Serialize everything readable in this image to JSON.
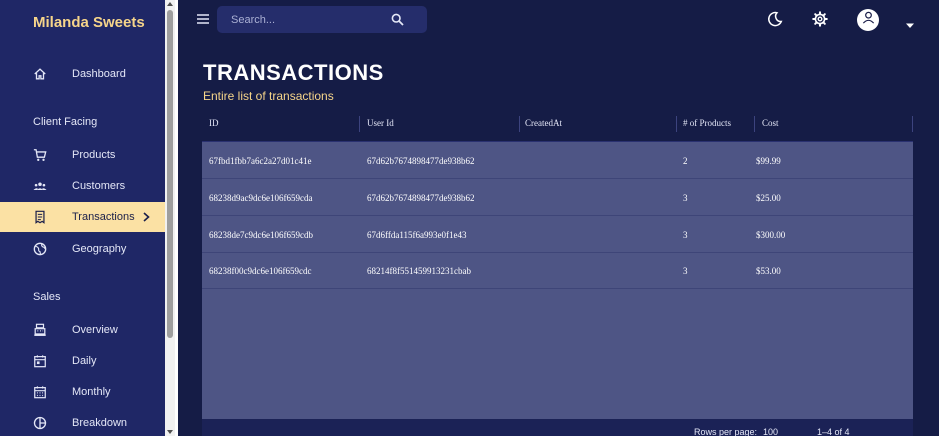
{
  "sidebar": {
    "brand": "Milanda Sweets",
    "items": [
      {
        "label": "Dashboard"
      },
      {
        "label": "Products"
      },
      {
        "label": "Customers"
      },
      {
        "label": "Transactions"
      },
      {
        "label": "Geography"
      },
      {
        "label": "Overview"
      },
      {
        "label": "Daily"
      },
      {
        "label": "Monthly"
      },
      {
        "label": "Breakdown"
      }
    ],
    "sections": [
      "Client Facing",
      "Sales"
    ],
    "active_item": "Transactions"
  },
  "topbar": {
    "search_placeholder": "Search...",
    "icons": [
      "menu-icon",
      "search-icon",
      "moon-icon",
      "settings-icon",
      "user-icon",
      "caret-down-icon"
    ]
  },
  "header": {
    "title": "TRANSACTIONS",
    "subtitle": "Entire list of transactions"
  },
  "table": {
    "columns": [
      "ID",
      "User Id",
      "CreatedAt",
      "# of Products",
      "Cost"
    ],
    "rows": [
      {
        "id": "67fbd1fbb7a6c2a27d01c41e",
        "user_id": "67d62b7674898477de938b62",
        "created_at": "",
        "products": "2",
        "cost": "$99.99"
      },
      {
        "id": "68238d9ac9dc6e106f659cda",
        "user_id": "67d62b7674898477de938b62",
        "created_at": "",
        "products": "3",
        "cost": "$25.00"
      },
      {
        "id": "68238de7c9dc6e106f659cdb",
        "user_id": "67d6ffda115f6a993e0f1e43",
        "created_at": "",
        "products": "3",
        "cost": "$300.00"
      },
      {
        "id": "68238f00c9dc6e106f659cdc",
        "user_id": "68214f8f551459913231cbab",
        "created_at": "",
        "products": "3",
        "cost": "$53.00"
      }
    ],
    "footer": {
      "rows_per_page_label": "Rows per page:",
      "rows_per_page_value": "100",
      "range": "1–4 of 4"
    }
  },
  "colors": {
    "sidebar_bg": "#1f2766",
    "page_bg": "#151c46",
    "accent": "#f6d58a",
    "active_bg": "#fbe1a4",
    "table_body_bg": "#4e5585"
  }
}
